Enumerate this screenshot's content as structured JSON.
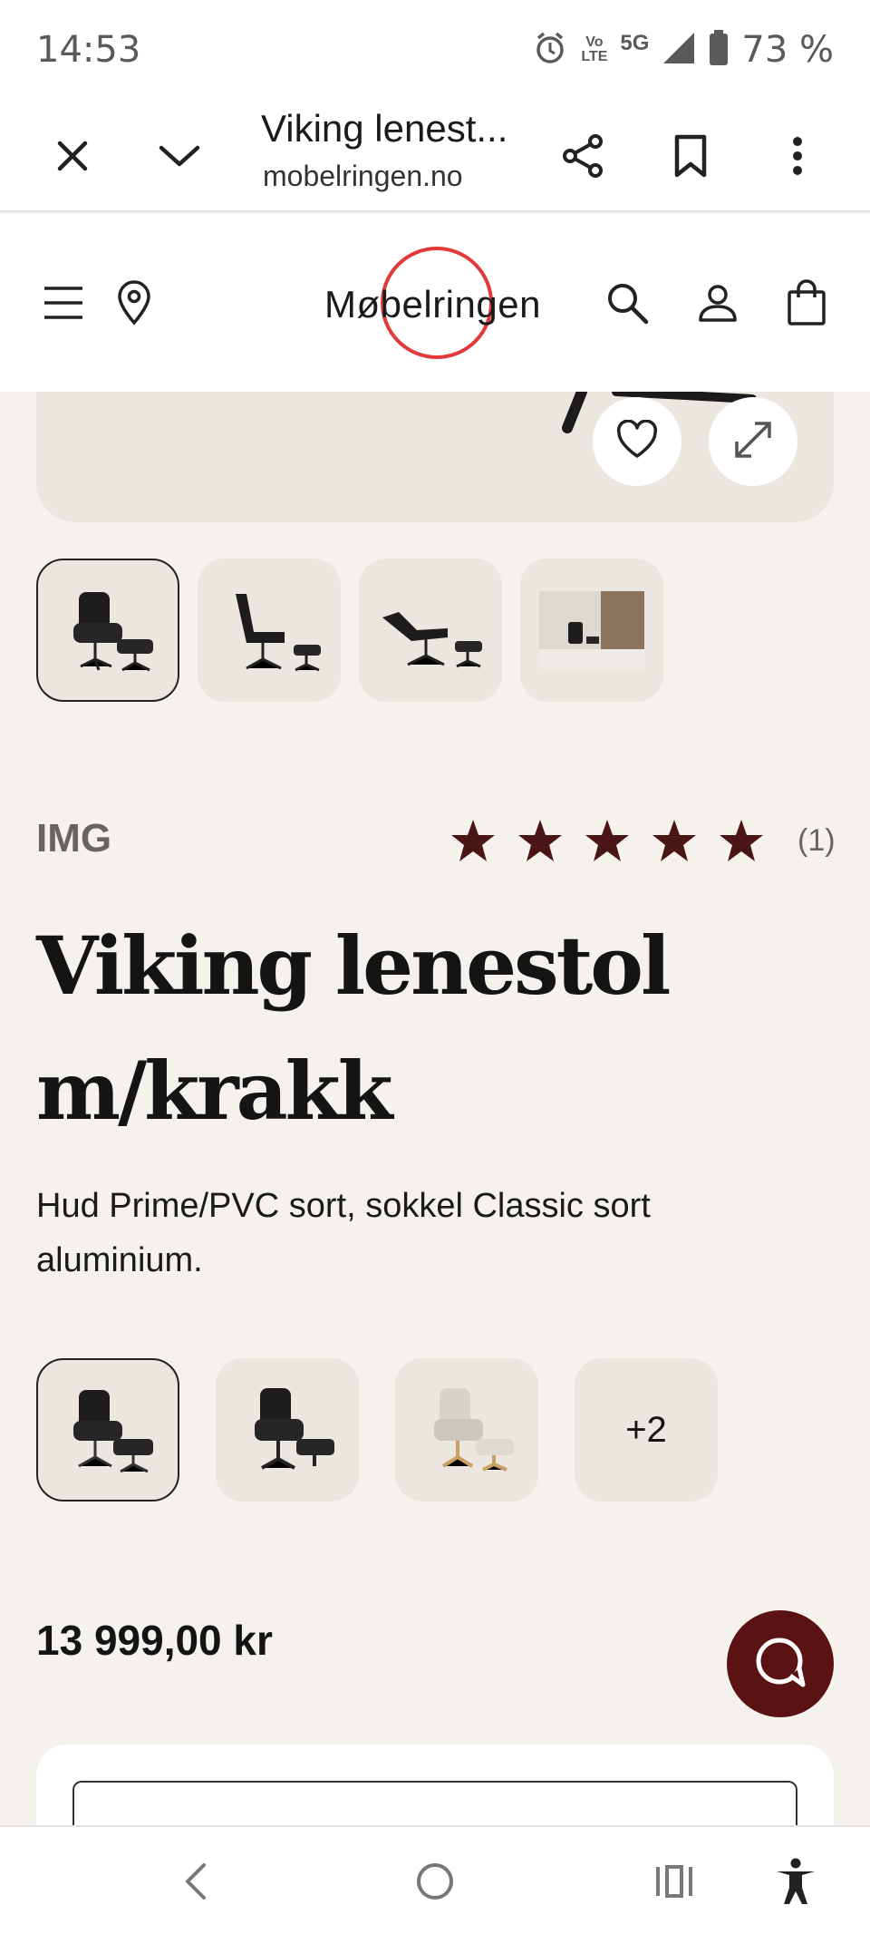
{
  "status_bar": {
    "time": "14:53",
    "network_volte_top": "Vo",
    "network_volte_bottom": "LTE",
    "network_5g": "5G",
    "battery": "73 %",
    "icons": [
      "alarm-icon",
      "volte-icon",
      "signal-icon",
      "battery-icon"
    ]
  },
  "browser": {
    "page_title": "Viking lenest...",
    "url": "mobelringen.no",
    "icons": [
      "close-icon",
      "chevron-down-icon",
      "share-icon",
      "bookmark-icon",
      "more-vert-icon"
    ]
  },
  "site_header": {
    "logo_text": "Møbelringen",
    "icons": [
      "menu-icon",
      "location-pin-icon",
      "search-icon",
      "account-icon",
      "shopping-bag-icon"
    ]
  },
  "gallery": {
    "thumbnail_count": 4,
    "selected_index": 0,
    "icons": [
      "heart-icon",
      "expand-icon"
    ]
  },
  "product": {
    "brand": "IMG",
    "rating": 5,
    "rating_max": 5,
    "review_count": "(1)",
    "title_line1": "Viking lenestol",
    "title_line2": "m/krakk",
    "description": "Hud Prime/PVC sort, sokkel Classic sort aluminium.",
    "variants_more": "+2",
    "price": "13 999,00 kr"
  },
  "colors": {
    "background": "#f5f2ee",
    "tile": "#ebe6df",
    "star": "#4a1515",
    "chat_button": "#5a1212",
    "logo_ring": "#e23a3a"
  },
  "nav_bar": {
    "icons": [
      "back-icon",
      "home-icon",
      "recents-icon",
      "accessibility-icon"
    ]
  }
}
